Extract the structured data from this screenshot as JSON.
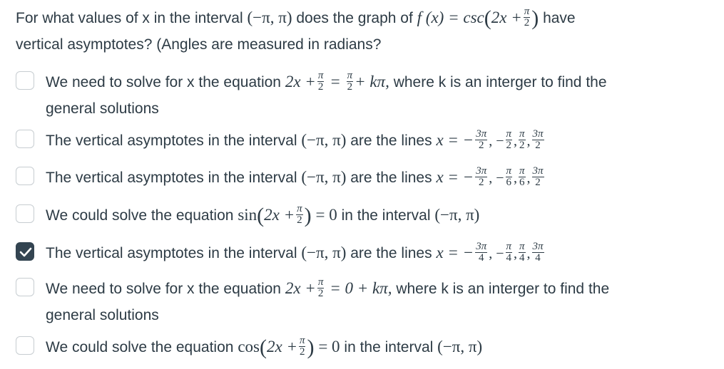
{
  "question": {
    "p1": "For what values of x in the interval",
    "interval": "(−π, π)",
    "p2": "does the graph of",
    "func_lhs": "f (x) = csc",
    "func_arg": "2x +",
    "frac_pi": "π",
    "frac_2": "2",
    "p3": "have",
    "p4": "vertical asymptotes? (Angles are measured in radians?"
  },
  "options": [
    {
      "checked": false,
      "l1": "We need to solve for x the equation",
      "eq_a": "2x +",
      "eq_b": "=",
      "eq_c": "+ kπ,",
      "l1b": "where k is an interger to find the",
      "l2": "general solutions"
    },
    {
      "checked": false,
      "text": "The vertical asymptotes in the interval",
      "interval": "(−π, π)",
      "text2": "are the lines",
      "eq": "x = −",
      "fracs": [
        [
          "3π",
          "2"
        ],
        [
          "π",
          "2"
        ],
        [
          "π",
          "2"
        ],
        [
          "3π",
          "2"
        ]
      ]
    },
    {
      "checked": false,
      "text": "The vertical asymptotes in the interval",
      "interval": "(−π, π)",
      "text2": "are the lines",
      "eq": "x = −",
      "fracs": [
        [
          "3π",
          "2"
        ],
        [
          "π",
          "6"
        ],
        [
          "π",
          "6"
        ],
        [
          "3π",
          "2"
        ]
      ]
    },
    {
      "checked": false,
      "text": "We could solve the equation",
      "fn": "sin",
      "arg": "2x +",
      "rhs": "= 0",
      "text2": "in the interval",
      "interval": "(−π, π)"
    },
    {
      "checked": true,
      "text": "The vertical asymptotes in the interval",
      "interval": "(−π, π)",
      "text2": "are the lines",
      "eq": "x = −",
      "fracs": [
        [
          "3π",
          "4"
        ],
        [
          "π",
          "4"
        ],
        [
          "π",
          "4"
        ],
        [
          "3π",
          "4"
        ]
      ]
    },
    {
      "checked": false,
      "l1": "We need to solve for x the equation",
      "eq_a": "2x +",
      "eq_c": "= 0 + kπ,",
      "l1b": "where k is an interger to find the",
      "l2": "general solutions"
    },
    {
      "checked": false,
      "text": "We could solve the equation",
      "fn": "cos",
      "arg": "2x +",
      "rhs": "= 0",
      "text2": "in the interval",
      "interval": "(−π, π)"
    }
  ]
}
